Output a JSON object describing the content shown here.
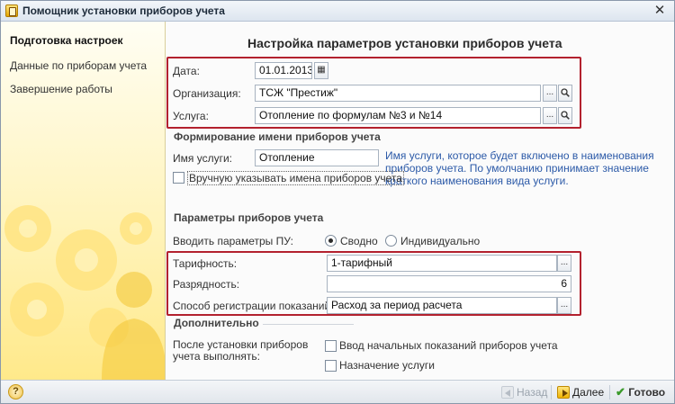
{
  "window": {
    "title": "Помощник установки приборов учета",
    "close_glyph": "✕"
  },
  "sidebar": {
    "items": [
      {
        "label": "Подготовка настроек",
        "active": true
      },
      {
        "label": "Данные по приборам учета",
        "active": false
      },
      {
        "label": "Завершение работы",
        "active": false
      }
    ]
  },
  "main": {
    "title": "Настройка параметров установки приборов учета",
    "date": {
      "label": "Дата:",
      "value": "01.01.2013"
    },
    "org": {
      "label": "Организация:",
      "value": "ТСЖ \"Престиж\""
    },
    "service": {
      "label": "Услуга:",
      "value": "Отопление по формулам №3 и №14"
    },
    "naming": {
      "section_title": "Формирование имени приборов учета",
      "service_name_label": "Имя услуги:",
      "service_name_value": "Отопление",
      "hint_lines": [
        "Имя услуги, которое будет включено в наименования",
        "приборов учета. По умолчанию принимает значение",
        "краткого наименования вида услуги."
      ],
      "manual_names_label": "Вручную указывать имена приборов учета"
    },
    "params": {
      "section_title": "Параметры приборов учета",
      "enter_label": "Вводить параметры ПУ:",
      "radio_summary": "Сводно",
      "radio_individual": "Индивидуально",
      "tariff_label": "Тарифность:",
      "tariff_value": "1-тарифный",
      "digits_label": "Разрядность:",
      "digits_value": "6",
      "reg_label": "Способ регистрации показаний:",
      "reg_value": "Расход за период расчета"
    },
    "extra": {
      "section_title": "Дополнительно",
      "after_label_line1": "После установки приборов",
      "after_label_line2": "учета выполнять:",
      "initial_readings_label": "Ввод начальных показаний приборов учета",
      "assign_service_label": "Назначение услуги"
    }
  },
  "bottombar": {
    "help": "?",
    "back": "Назад",
    "next": "Далее",
    "done": "Готово"
  },
  "icons": {
    "ellipsis": "...",
    "search": "🔍",
    "calendar": "calendar-icon",
    "done_check": "✔"
  }
}
